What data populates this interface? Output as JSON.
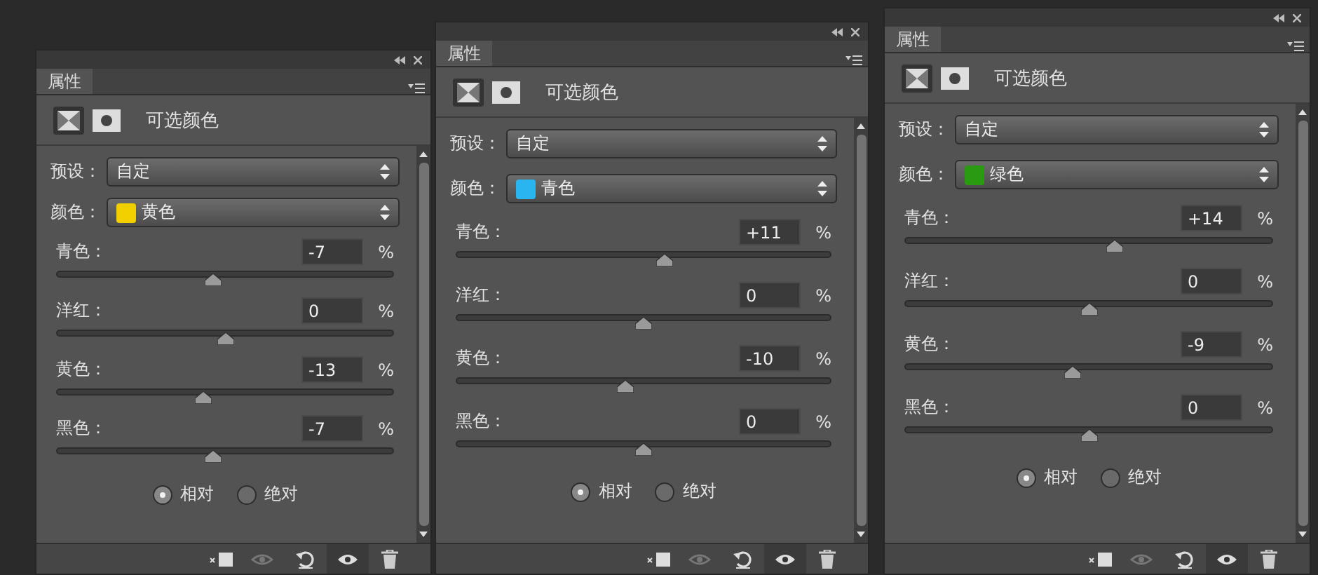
{
  "panels": [
    {
      "tab": "属性",
      "title": "可选颜色",
      "preset": {
        "label": "预设：",
        "value": "自定"
      },
      "color": {
        "label": "颜色：",
        "value": "黄色",
        "color": "#f2d000"
      },
      "sliders": [
        {
          "label": "青色：",
          "value": "-7",
          "unit": "%",
          "level": 0.465
        },
        {
          "label": "洋红：",
          "value": "0",
          "unit": "%",
          "level": 0.5
        },
        {
          "label": "黄色：",
          "value": "-13",
          "unit": "%",
          "level": 0.435
        },
        {
          "label": "黑色：",
          "value": "-7",
          "unit": "%",
          "level": 0.465
        }
      ],
      "modes": [
        {
          "label": "相对",
          "selected": true
        },
        {
          "label": "绝对",
          "selected": false
        }
      ]
    },
    {
      "tab": "属性",
      "title": "可选颜色",
      "preset": {
        "label": "预设：",
        "value": "自定"
      },
      "color": {
        "label": "颜色：",
        "value": "青色",
        "color": "#29b6f0"
      },
      "sliders": [
        {
          "label": "青色：",
          "value": "+11",
          "unit": "%",
          "level": 0.555
        },
        {
          "label": "洋红：",
          "value": "0",
          "unit": "%",
          "level": 0.5
        },
        {
          "label": "黄色：",
          "value": "-10",
          "unit": "%",
          "level": 0.45
        },
        {
          "label": "黑色：",
          "value": "0",
          "unit": "%",
          "level": 0.5
        }
      ],
      "modes": [
        {
          "label": "相对",
          "selected": true
        },
        {
          "label": "绝对",
          "selected": false
        }
      ]
    },
    {
      "tab": "属性",
      "title": "可选颜色",
      "preset": {
        "label": "预设：",
        "value": "自定"
      },
      "color": {
        "label": "颜色：",
        "value": "绿色",
        "color": "#2a9a10"
      },
      "sliders": [
        {
          "label": "青色：",
          "value": "+14",
          "unit": "%",
          "level": 0.57
        },
        {
          "label": "洋红：",
          "value": "0",
          "unit": "%",
          "level": 0.5
        },
        {
          "label": "黄色：",
          "value": "-9",
          "unit": "%",
          "level": 0.455
        },
        {
          "label": "黑色：",
          "value": "0",
          "unit": "%",
          "level": 0.5
        }
      ],
      "modes": [
        {
          "label": "相对",
          "selected": true
        },
        {
          "label": "绝对",
          "selected": false
        }
      ]
    }
  ]
}
